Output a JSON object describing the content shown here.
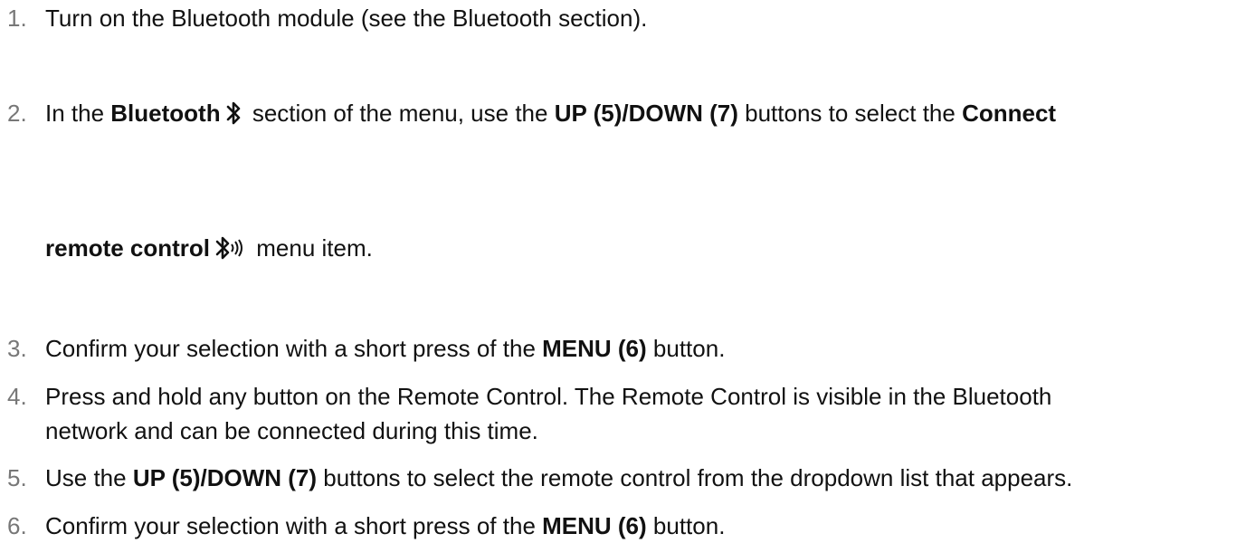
{
  "steps": [
    {
      "number": "1.",
      "parts": [
        "Turn on the Bluetooth module (see the ",
        "Bluetooth",
        " section)."
      ]
    },
    {
      "number": "2.",
      "line1": [
        "In the ",
        "Bluetooth",
        " section of the menu, use the ",
        "UP (5)/DOWN (7)",
        " buttons to select the ",
        "Connect"
      ],
      "line2": [
        "remote control",
        " menu item."
      ],
      "icons": [
        "bluetooth-icon",
        "bluetooth-remote-icon"
      ]
    },
    {
      "number": "3.",
      "parts": [
        "Confirm your selection with a short press of the ",
        "MENU (6)",
        " button."
      ]
    },
    {
      "number": "4.",
      "line1": "Press and hold any button on the Remote Control. The Remote Control is visible in the Bluetooth",
      "line2": "network and can be connected during this time."
    },
    {
      "number": "5.",
      "parts": [
        "Use the ",
        "UP (5)/DOWN (7)",
        " buttons to select the remote control from the dropdown list that appears."
      ]
    },
    {
      "number": "6.",
      "parts": [
        "Confirm your selection with a short press of the ",
        "MENU (6)",
        " button."
      ]
    }
  ]
}
